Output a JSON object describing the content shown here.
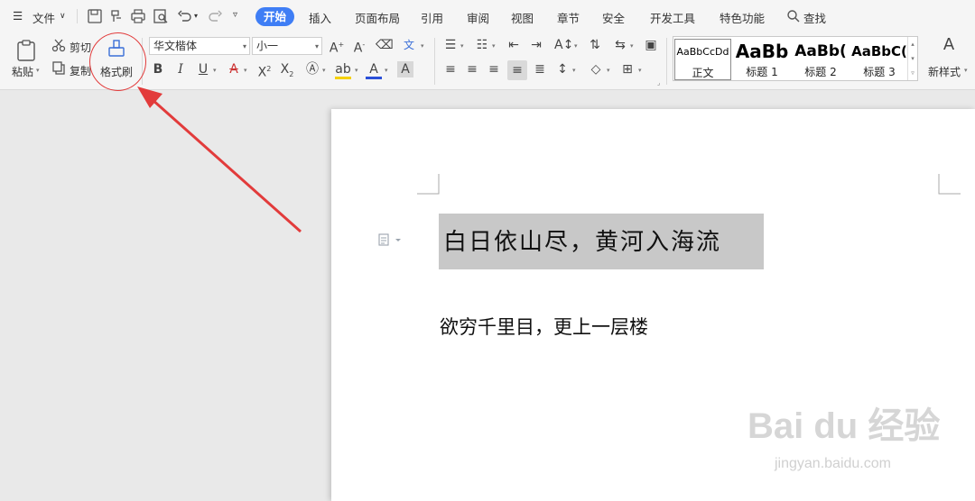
{
  "menubar": {
    "file_label": "文件",
    "tabs": [
      "开始",
      "插入",
      "页面布局",
      "引用",
      "审阅",
      "视图",
      "章节",
      "安全",
      "开发工具",
      "特色功能"
    ],
    "search_label": "查找"
  },
  "ribbon": {
    "paste": "粘贴",
    "cut": "剪切",
    "copy": "复制",
    "format_painter": "格式刷",
    "font_name": "华文楷体",
    "font_size": "小一",
    "styles": [
      {
        "sample": "AaBbCcDd",
        "name": "正文"
      },
      {
        "sample": "AaBb",
        "name": "标题 1"
      },
      {
        "sample": "AaBb(",
        "name": "标题 2"
      },
      {
        "sample": "AaBbC(",
        "name": "标题 3"
      }
    ],
    "new_style": "新样式"
  },
  "document": {
    "line1": "白日依山尽，黄河入海流",
    "line2": "欲穷千里目，更上一层楼"
  },
  "watermark": {
    "brand": "Bai du 经验",
    "url": "jingyan.baidu.com"
  },
  "colors": {
    "accent": "#3f7ef5",
    "annotation": "#e23b3b",
    "highlight": "#c8c8c8"
  }
}
